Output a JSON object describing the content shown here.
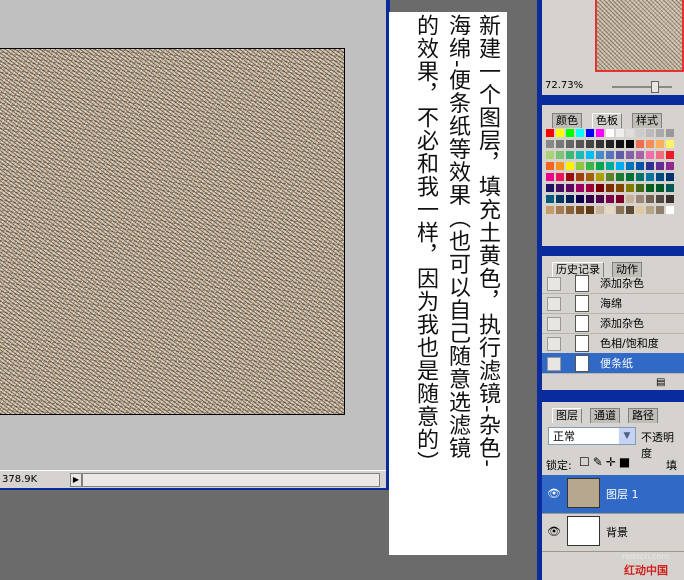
{
  "document": {
    "doc_size": "378.9K"
  },
  "annotation": {
    "columns": [
      "新建一个图层，填充土黄色，执行滤镜-杂色-",
      "海绵-便条纸等效果（也可以自己随意选滤镜",
      "的效果，不必和我一样，因为我也是随意的）"
    ]
  },
  "navigator": {
    "zoom": "72.73%",
    "zoom_fraction": 0.7
  },
  "swatch_panel": {
    "tabs": [
      "颜色",
      "色板",
      "样式"
    ],
    "active_tab": "色板",
    "colors": [
      [
        "#ff0000",
        "#ffff00",
        "#00ff00",
        "#00ffff",
        "#0000ff",
        "#ff00ff",
        "#ffffff",
        "#eeeeee",
        "#dddddd",
        "#cccccc",
        "#bbbbbb",
        "#aaaaaa",
        "#999999"
      ],
      [
        "#888888",
        "#777777",
        "#666666",
        "#555555",
        "#444444",
        "#333333",
        "#222222",
        "#111111",
        "#000000",
        "#f26c4f",
        "#f68e55",
        "#fbaf5c",
        "#fff467"
      ],
      [
        "#acd372",
        "#7cc576",
        "#3bb878",
        "#1abbb4",
        "#00bff3",
        "#438cca",
        "#5574b9",
        "#605ca8",
        "#855fa8",
        "#a763a8",
        "#f06ea9",
        "#f26d7d",
        "#ed1c24"
      ],
      [
        "#f26522",
        "#f7941d",
        "#fff200",
        "#8dc63f",
        "#39b54a",
        "#00a651",
        "#00a99d",
        "#00aeef",
        "#0072bc",
        "#0054a6",
        "#2e3192",
        "#662d91",
        "#92278f"
      ],
      [
        "#ec008c",
        "#ed145b",
        "#9e0b0f",
        "#a0410d",
        "#a36209",
        "#aba000",
        "#598527",
        "#1a7b30",
        "#007236",
        "#00746b",
        "#0076a3",
        "#004b80",
        "#003471"
      ],
      [
        "#1b1464",
        "#440e62",
        "#630460",
        "#9e005d",
        "#9e0039",
        "#790000",
        "#7b2e00",
        "#7d4900",
        "#827b00",
        "#406618",
        "#005e20",
        "#005826",
        "#005952"
      ],
      [
        "#005b7f",
        "#003663",
        "#002157",
        "#0d004c",
        "#32004b",
        "#4b0049",
        "#7b0046",
        "#7a0026",
        "#c7b299",
        "#998675",
        "#736357",
        "#534741",
        "#37302a"
      ],
      [
        "#c69c6d",
        "#a67c52",
        "#8c6239",
        "#754c24",
        "#603913",
        "#c7b299",
        "#e6d8c3",
        "#8b7355",
        "#5c4b32",
        "#e0c8a0",
        "#b8a58a",
        "#8f7f6a",
        "#ffffff"
      ]
    ]
  },
  "history_panel": {
    "tabs": [
      "历史记录",
      "动作"
    ],
    "items": [
      {
        "label": "添加杂色",
        "selected": false
      },
      {
        "label": "海绵",
        "selected": false
      },
      {
        "label": "添加杂色",
        "selected": false
      },
      {
        "label": "色相/饱和度",
        "selected": false
      },
      {
        "label": "便条纸",
        "selected": true
      }
    ]
  },
  "layers_panel": {
    "tabs": [
      "图层",
      "通道",
      "路径"
    ],
    "blend_mode": "正常",
    "opacity_label": "不透明度",
    "lock_label": "锁定:",
    "fill_label": "填充",
    "layers": [
      {
        "name": "图层 1",
        "selected": true,
        "thumb": "#b7a78f"
      },
      {
        "name": "背景",
        "selected": false,
        "thumb": "#ffffff"
      }
    ]
  },
  "watermark": {
    "url": "redocn.com",
    "name": "红动中国"
  }
}
